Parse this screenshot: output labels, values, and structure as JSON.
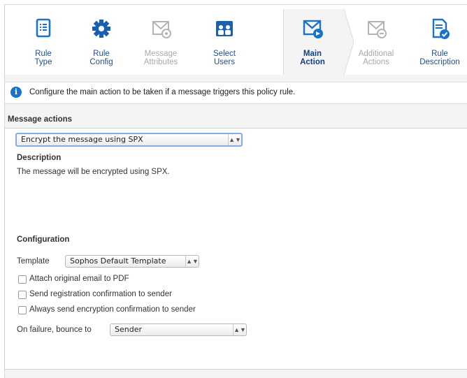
{
  "steps": [
    {
      "label": "Rule\nType",
      "icon": "list-icon",
      "state": "normal"
    },
    {
      "label": "Rule\nConfig",
      "icon": "gear-icon",
      "state": "normal"
    },
    {
      "label": "Message\nAttributes",
      "icon": "envelope-gear-icon",
      "state": "disabled"
    },
    {
      "label": "Select\nUsers",
      "icon": "users-icon",
      "state": "normal"
    },
    {
      "label": "Main\nAction",
      "icon": "envelope-action-icon",
      "state": "active"
    },
    {
      "label": "Additional\nActions",
      "icon": "envelope-extra-icon",
      "state": "disabled"
    },
    {
      "label": "Rule\nDescription",
      "icon": "document-check-icon",
      "state": "normal"
    }
  ],
  "info": {
    "text": "Configure the main action to be taken if a message triggers this policy rule."
  },
  "message_actions": {
    "title": "Message actions",
    "selected": "Encrypt the message using SPX"
  },
  "description": {
    "title": "Description",
    "text": "The message will be encrypted using SPX."
  },
  "configuration": {
    "title": "Configuration",
    "template_label": "Template",
    "template_value": "Sophos Default Template",
    "checkboxes": [
      {
        "label": "Attach original email to PDF",
        "checked": false
      },
      {
        "label": "Send registration confirmation to sender",
        "checked": false
      },
      {
        "label": "Always send encryption confirmation to sender",
        "checked": false
      }
    ],
    "bounce_label": "On failure, bounce to",
    "bounce_value": "Sender"
  },
  "colors": {
    "accent": "#1a73c6",
    "step_label": "#1f4e8c",
    "disabled": "#a8a8a8"
  }
}
